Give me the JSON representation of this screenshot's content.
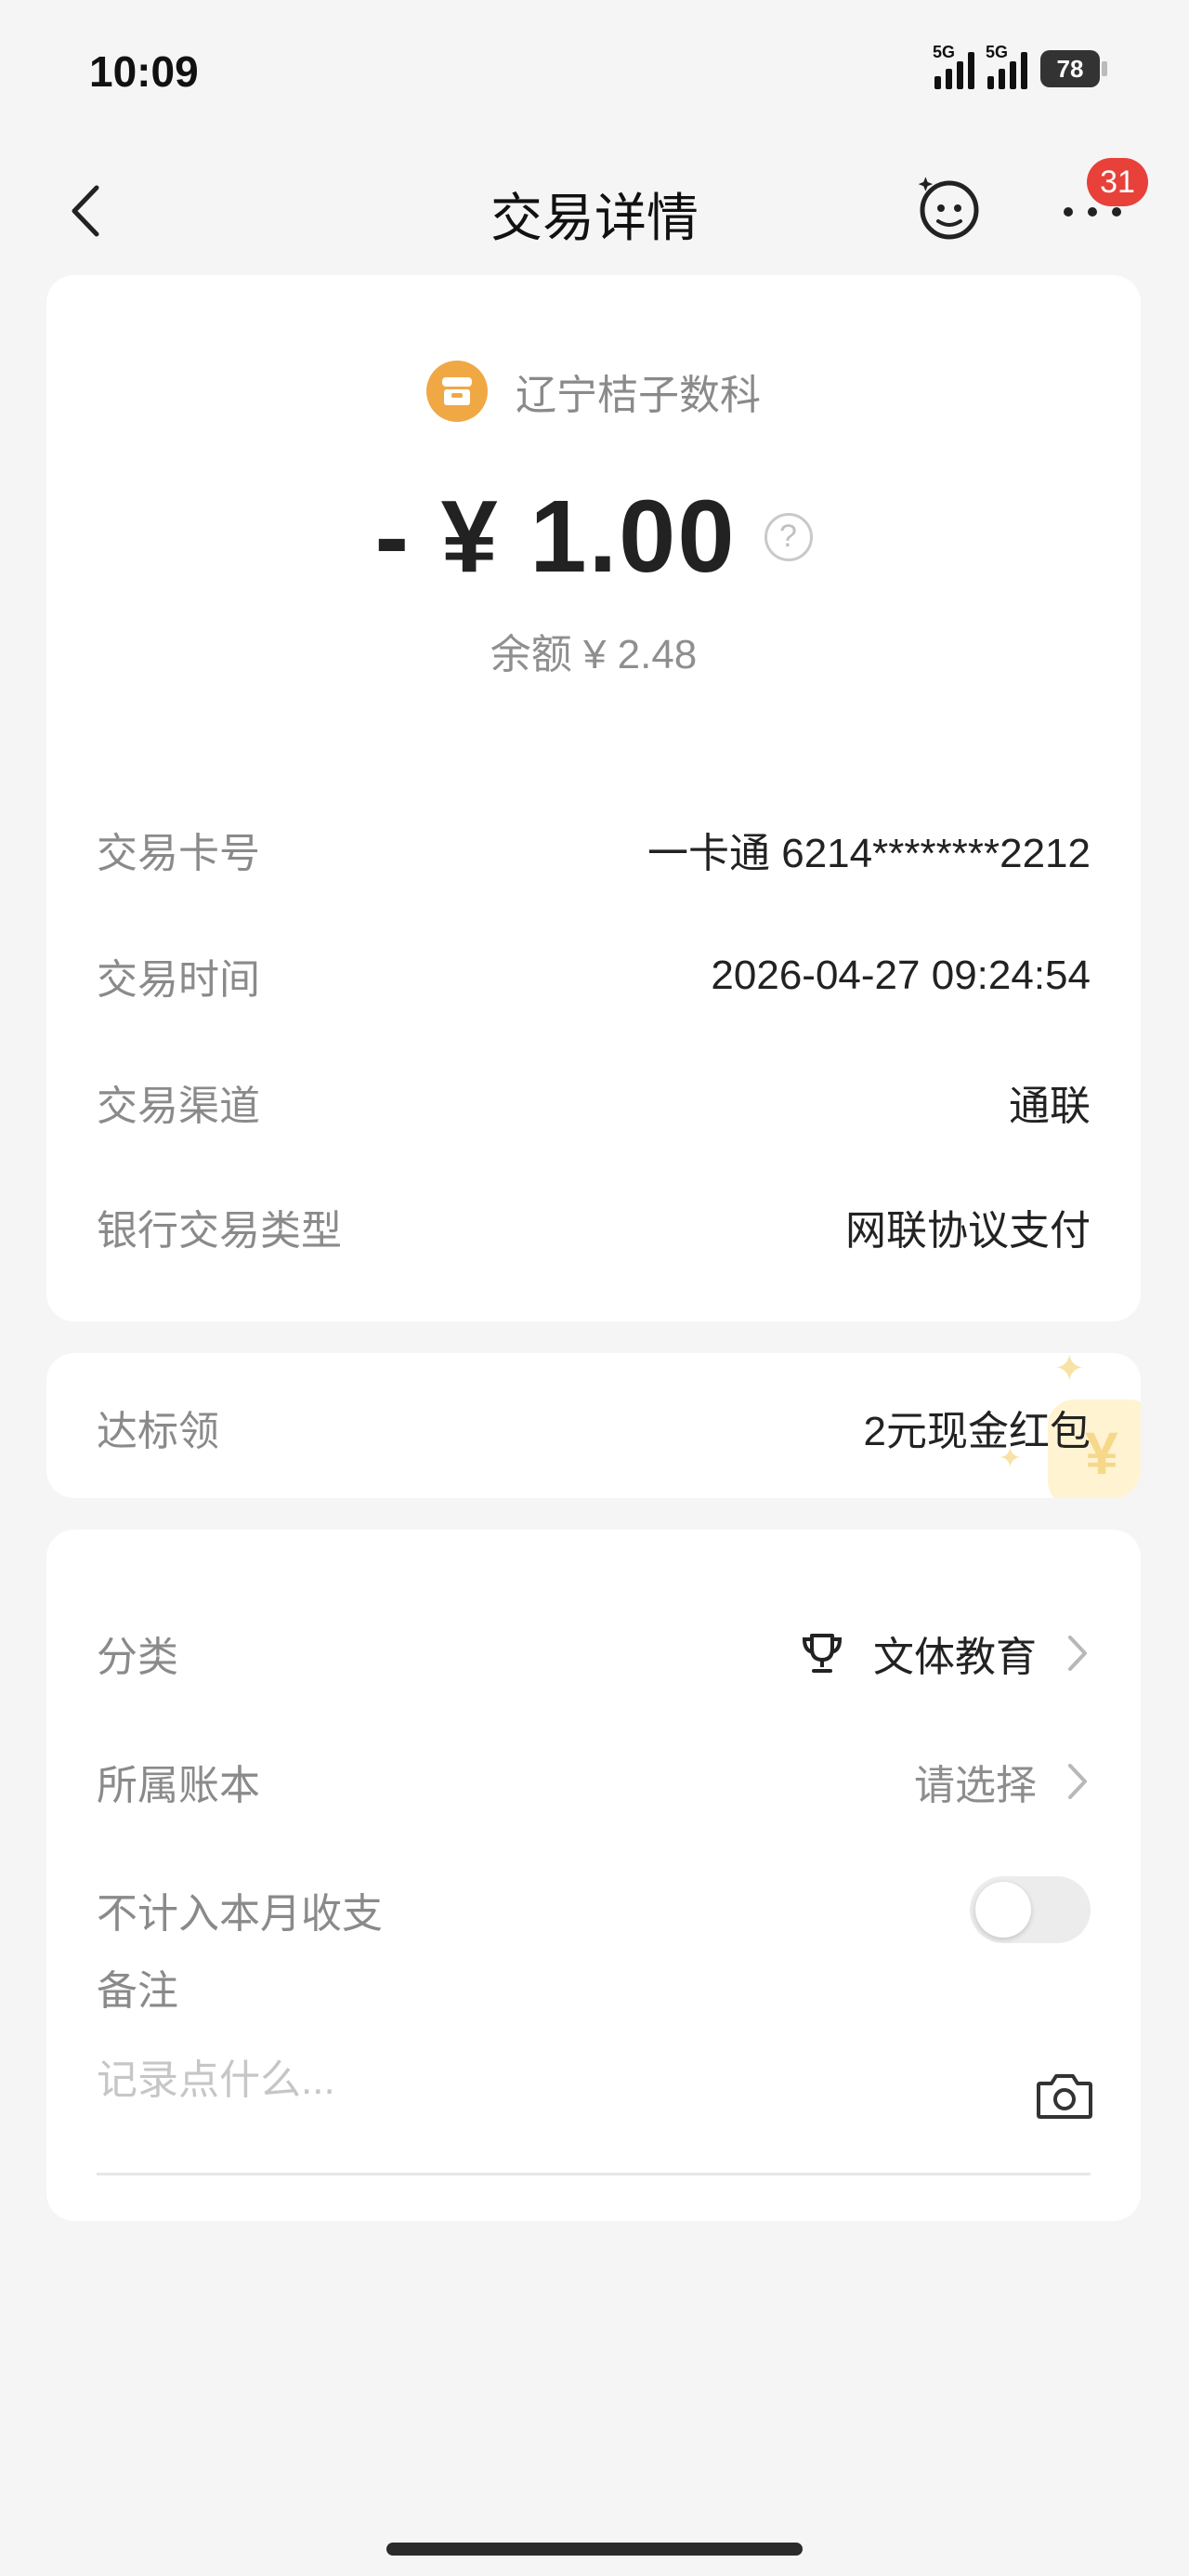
{
  "status_bar": {
    "time": "10:09",
    "network_1": "5G",
    "network_2": "5G",
    "battery": "78"
  },
  "nav": {
    "title": "交易详情",
    "badge_count": "31"
  },
  "transaction": {
    "merchant": "辽宁桔子数科",
    "amount": "- ¥ 1.00",
    "help_symbol": "?",
    "balance": "余额 ¥ 2.48",
    "details": [
      {
        "label": "交易卡号",
        "value": "一卡通 6214********2212"
      },
      {
        "label": "交易时间",
        "value": "2026-04-27 09:24:54"
      },
      {
        "label": "交易渠道",
        "value": "通联"
      },
      {
        "label": "银行交易类型",
        "value": "网联协议支付"
      }
    ]
  },
  "reward": {
    "label": "达标领",
    "value": "2元现金红包",
    "deco_symbol": "¥"
  },
  "settings": {
    "category_label": "分类",
    "category_value": "文体教育",
    "book_label": "所属账本",
    "book_value": "请选择",
    "exclude_label": "不计入本月收支",
    "exclude_on": false,
    "note_label": "备注",
    "note_placeholder": "记录点什么...",
    "note_value": ""
  },
  "colors": {
    "background": "#f5f5f5",
    "card": "#ffffff",
    "merchant_icon": "#f0a845",
    "badge": "#e8413a"
  }
}
